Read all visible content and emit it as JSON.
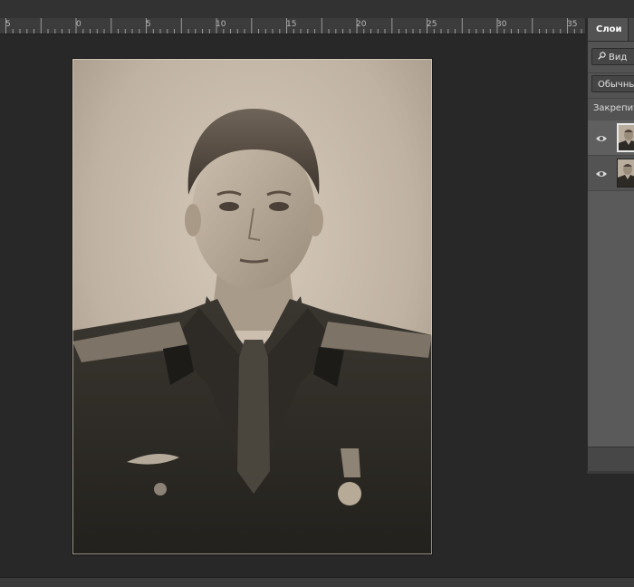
{
  "ruler": {
    "labels": [
      "5",
      "0",
      "5",
      "10",
      "15",
      "20",
      "25",
      "30",
      "35"
    ]
  },
  "layers_panel": {
    "tab_label": "Слои",
    "filter_kind_label": "Вид",
    "blend_mode_value": "Обычные",
    "lock_label": "Закрепить:",
    "layers": [
      {
        "selected": true,
        "visible": true,
        "icon": "eye-icon"
      },
      {
        "selected": false,
        "visible": true,
        "icon": "eye-icon"
      }
    ]
  },
  "colors": {
    "canvas_bg": "#282828",
    "panel_bg": "#535353",
    "ruler_bg": "#3c3c3c",
    "photo_tone": "#b8ab9b"
  }
}
